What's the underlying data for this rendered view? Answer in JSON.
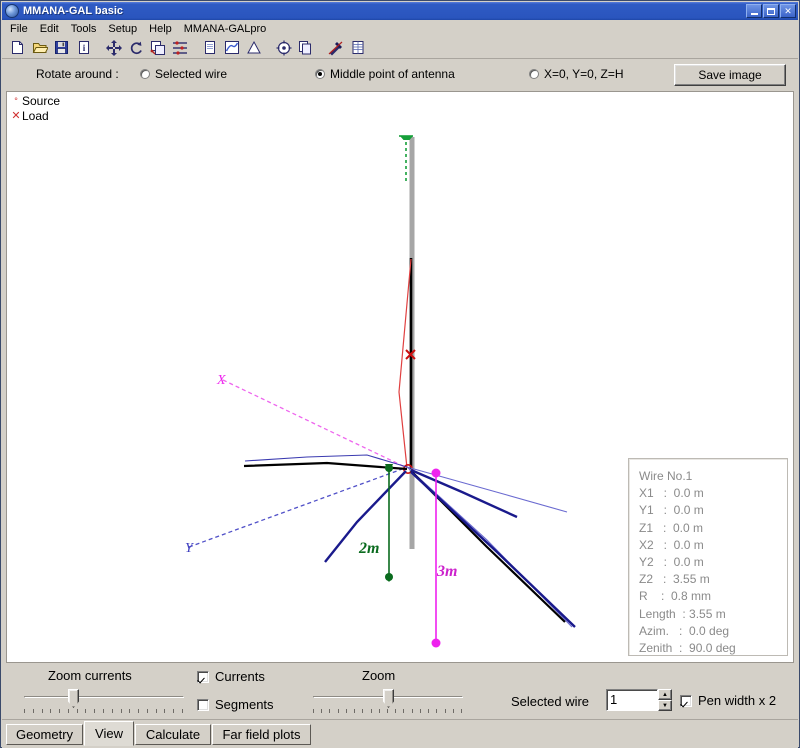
{
  "window": {
    "title": "MMANA-GAL basic",
    "icon": "app-globe-icon",
    "minimize": "minimize-button",
    "maximize": "maximize-button",
    "close_label": "✕"
  },
  "menu": {
    "items": [
      "File",
      "Edit",
      "Tools",
      "Setup",
      "Help",
      "MMANA-GALpro"
    ]
  },
  "toolbar": {
    "buttons": [
      {
        "name": "new-file-icon",
        "glyph": "page"
      },
      {
        "name": "open-file-icon",
        "glyph": "folder"
      },
      {
        "name": "save-file-icon",
        "glyph": "floppy"
      },
      {
        "name": "info-icon",
        "glyph": "info"
      },
      {
        "name": "move-icon",
        "glyph": "move"
      },
      {
        "name": "rotate-icon",
        "glyph": "rotate"
      },
      {
        "name": "scale-icon",
        "glyph": "scale"
      },
      {
        "name": "segments-icon",
        "glyph": "segments"
      },
      {
        "name": "geometry-page-icon",
        "glyph": "page2"
      },
      {
        "name": "view-plot-icon",
        "glyph": "curve"
      },
      {
        "name": "far-field-icon",
        "glyph": "triangle"
      },
      {
        "name": "target-icon",
        "glyph": "target"
      },
      {
        "name": "copy-icon",
        "glyph": "copy"
      },
      {
        "name": "tools-icon",
        "glyph": "hammer"
      },
      {
        "name": "table-icon",
        "glyph": "table"
      }
    ]
  },
  "options": {
    "rotate_label": "Rotate around :",
    "radios": [
      {
        "label": "Selected wire",
        "selected": false
      },
      {
        "label": "Middle point of antenna",
        "selected": true
      },
      {
        "label": "X=0, Y=0, Z=H",
        "selected": false
      }
    ],
    "save_image_label": "Save image"
  },
  "canvas": {
    "legend": [
      {
        "marker": "°",
        "label": "Source",
        "color": "#cc2020"
      },
      {
        "marker": "✕",
        "label": "Load",
        "color": "#cc2020"
      }
    ],
    "axis_labels": [
      {
        "text": "X",
        "color": "#ee44dd"
      },
      {
        "text": "Y",
        "color": "#4040c0"
      }
    ],
    "dimension_labels": [
      {
        "text": "2m",
        "color": "#0a6b1e"
      },
      {
        "text": "3m",
        "color": "#cc22cc"
      }
    ]
  },
  "info_panel": {
    "title": "Wire No.1",
    "rows": [
      "X1   :  0.0 m",
      "Y1   :  0.0 m",
      "Z1   :  0.0 m",
      "X2   :  0.0 m",
      "Y2   :  0.0 m",
      "Z2   :  3.55 m",
      "R    :  0.8 mm",
      "Length  : 3.55 m",
      "Azim.   :  0.0 deg",
      "Zenith  :  90.0 deg"
    ]
  },
  "bottom": {
    "zoom_currents_label": "Zoom currents",
    "zoom_label": "Zoom",
    "currents_checkbox": {
      "label": "Currents",
      "checked": true
    },
    "segments_checkbox": {
      "label": "Segments",
      "checked": false
    },
    "selected_wire_label": "Selected wire",
    "selected_wire_value": "1",
    "spin_up": "▲",
    "spin_down": "▼",
    "pen_width_checkbox": {
      "label": "Pen width x 2",
      "checked": true
    }
  },
  "tabs": [
    {
      "label": "Geometry",
      "active": false
    },
    {
      "label": "View",
      "active": true
    },
    {
      "label": "Calculate",
      "active": false
    },
    {
      "label": "Far field plots",
      "active": false
    }
  ],
  "colors": {
    "face": "#d4d0c8",
    "title_blue": "#2a55be",
    "wire_black": "#000000",
    "wire_navy": "#1a1a8c",
    "source_red": "#cc2020",
    "green": "#0a6b1e",
    "magenta": "#ee22ee",
    "mast_gray": "#a6a6a6"
  }
}
